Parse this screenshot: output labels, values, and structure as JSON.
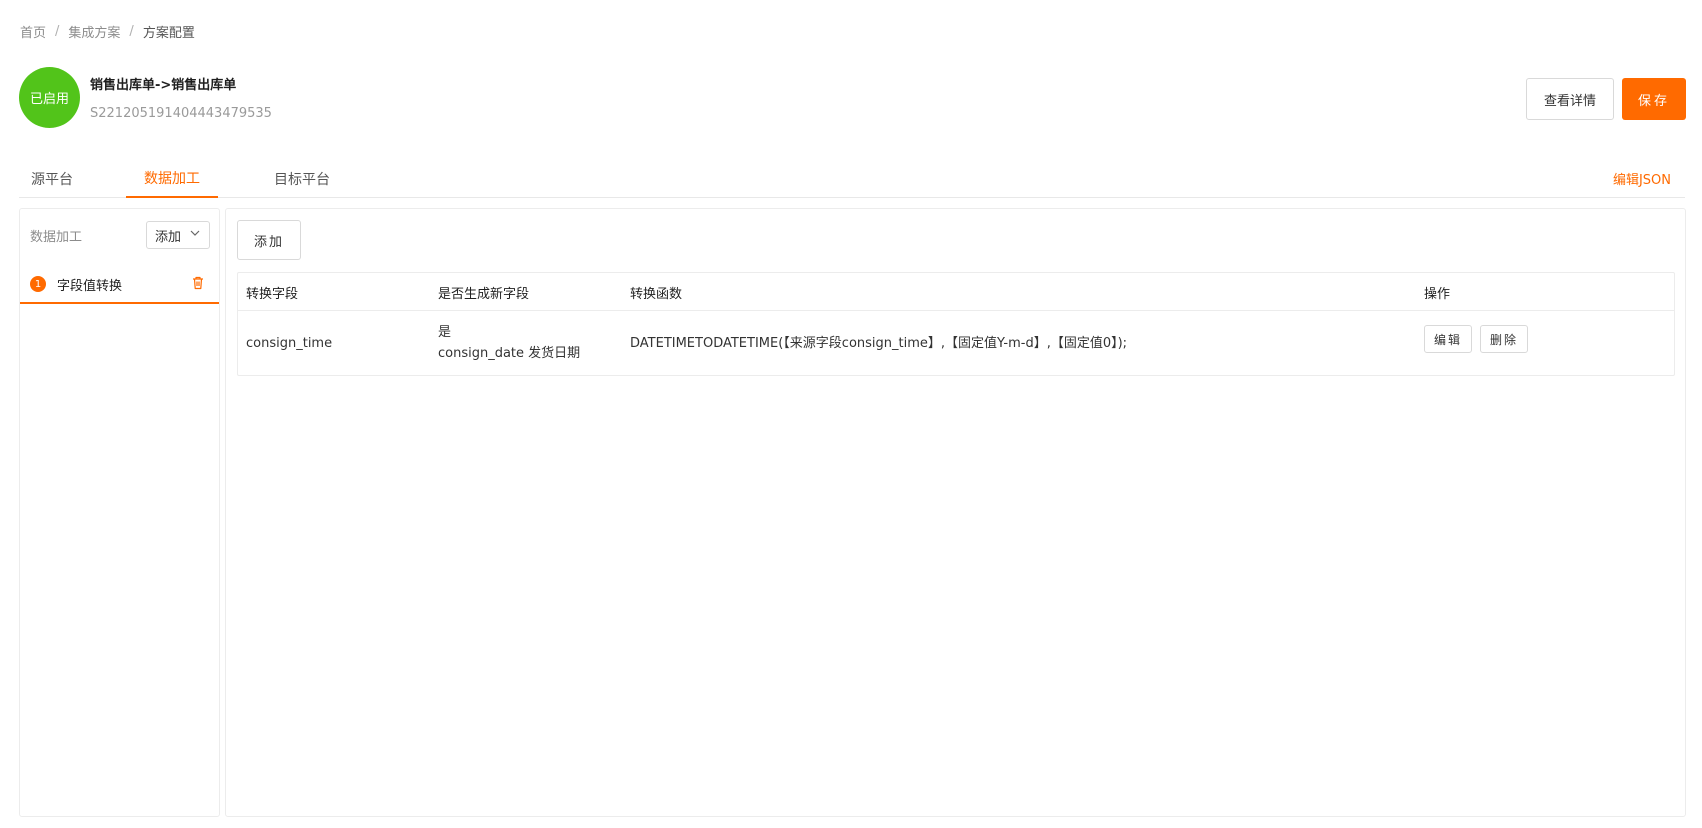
{
  "breadcrumb": {
    "items": [
      "首页",
      "集成方案",
      "方案配置"
    ],
    "separator": "/"
  },
  "header": {
    "status": "已启用",
    "status_color": "#52c41a",
    "title": "销售出库单->销售出库单",
    "code": "S2212051914044434795 35",
    "detail_button": "查看详情",
    "save_button": "保存"
  },
  "tabs": {
    "items": [
      "源平台",
      "数据加工",
      "目标平台"
    ],
    "active": "数据加工",
    "edit_json": "编辑JSON"
  },
  "left_panel": {
    "label": "数据加工",
    "add_select": "添加",
    "steps": [
      {
        "number": "1",
        "label": "字段值转换",
        "icon": "trash-icon"
      }
    ]
  },
  "main": {
    "add_button": "添加",
    "table": {
      "headers": [
        "转换字段",
        "是否生成新字段",
        "转换函数",
        "操作"
      ],
      "rows": [
        {
          "field": "consign_time",
          "new_field_flag": "是",
          "new_field_desc": "consign_date 发货日期",
          "function": "DATETIMETODATETIME(【来源字段consign_time】,【固定值Y-m-d】,【固定值0】);",
          "edit": "编辑",
          "delete": "删除"
        }
      ]
    }
  },
  "colors": {
    "accent": "#ff6a00",
    "success": "#52c41a"
  }
}
